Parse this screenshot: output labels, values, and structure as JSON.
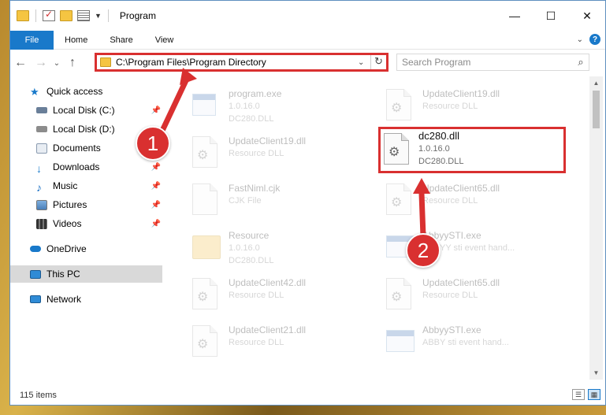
{
  "window": {
    "title": "Program",
    "controls": {
      "minimize": "—",
      "maximize": "☐",
      "close": "✕"
    }
  },
  "ribbon": {
    "tabs": [
      "File",
      "Home",
      "Share",
      "View"
    ],
    "help": "?"
  },
  "address": {
    "path": "C:\\Program Files\\Program Directory",
    "refresh": "↻",
    "dropdown": "⌄"
  },
  "search": {
    "placeholder": "Search Program",
    "icon": "⌕"
  },
  "nav": {
    "back": "←",
    "forward": "→",
    "recent": "⌄",
    "up": "↑",
    "items": [
      {
        "label": "Quick access",
        "icon": "star-icon",
        "color": "#1979ca"
      },
      {
        "label": "Local Disk (C:)",
        "icon": "drive-icon",
        "color": "#6a7f99",
        "pinned": true
      },
      {
        "label": "Local Disk (D:)",
        "icon": "drive-icon",
        "color": "#8c8c8c"
      },
      {
        "label": "Documents",
        "icon": "documents-icon",
        "color": "#a9b5c4",
        "pinned": true
      },
      {
        "label": "Downloads",
        "icon": "downloads-icon",
        "color": "#1979ca",
        "pinned": true
      },
      {
        "label": "Music",
        "icon": "music-icon",
        "color": "#1a6fc4",
        "pinned": true
      },
      {
        "label": "Pictures",
        "icon": "pictures-icon",
        "color": "#4a7fb8",
        "pinned": true
      },
      {
        "label": "Videos",
        "icon": "videos-icon",
        "color": "#555555",
        "pinned": true
      },
      {
        "label": "OneDrive",
        "icon": "cloud-icon",
        "color": "#1979ca"
      },
      {
        "label": "This PC",
        "icon": "pc-icon",
        "color": "#2f8bd6",
        "selected": true
      },
      {
        "label": "Network",
        "icon": "network-icon",
        "color": "#2f8bd6"
      }
    ],
    "pin": "📌"
  },
  "files": [
    {
      "name": "program.exe",
      "line2": "1.0.16.0",
      "line3": "DC280.DLL",
      "icon": "program-icon"
    },
    {
      "name": "UpdateClient19.dll",
      "line2": "Resource DLL",
      "line3": "",
      "icon": "dll-icon"
    },
    {
      "name": "UpdateClient19.dll",
      "line2": "Resource DLL",
      "line3": "",
      "icon": "dll-icon"
    },
    {
      "name": "dc280.dll",
      "line2": "1.0.16.0",
      "line3": "DC280.DLL",
      "icon": "dll-icon"
    },
    {
      "name": "FastNiml.cjk",
      "line2": "CJK File",
      "line3": "",
      "icon": "file-icon"
    },
    {
      "name": "UpdateClient65.dll",
      "line2": "Resource DLL",
      "line3": "",
      "icon": "dll-icon"
    },
    {
      "name": "Resource",
      "line2": "1.0.16.0",
      "line3": "DC280.DLL",
      "icon": "folder-icon"
    },
    {
      "name": "AbbyySTI.exe",
      "line2": "ABBYY sti event hand...",
      "line3": "",
      "icon": "exe-icon"
    },
    {
      "name": "UpdateClient42.dll",
      "line2": "Resource DLL",
      "line3": "",
      "icon": "dll-icon"
    },
    {
      "name": "UpdateClient65.dll",
      "line2": "Resource DLL",
      "line3": "",
      "icon": "dll-icon"
    },
    {
      "name": "UpdateClient21.dll",
      "line2": "Resource DLL",
      "line3": "",
      "icon": "dll-icon"
    },
    {
      "name": "AbbyySTI.exe",
      "line2": "ABBY sti event hand...",
      "line3": "",
      "icon": "exe-icon"
    }
  ],
  "status": {
    "count": "115 items"
  },
  "callouts": {
    "one": "1",
    "two": "2",
    "color": "#d93030"
  }
}
